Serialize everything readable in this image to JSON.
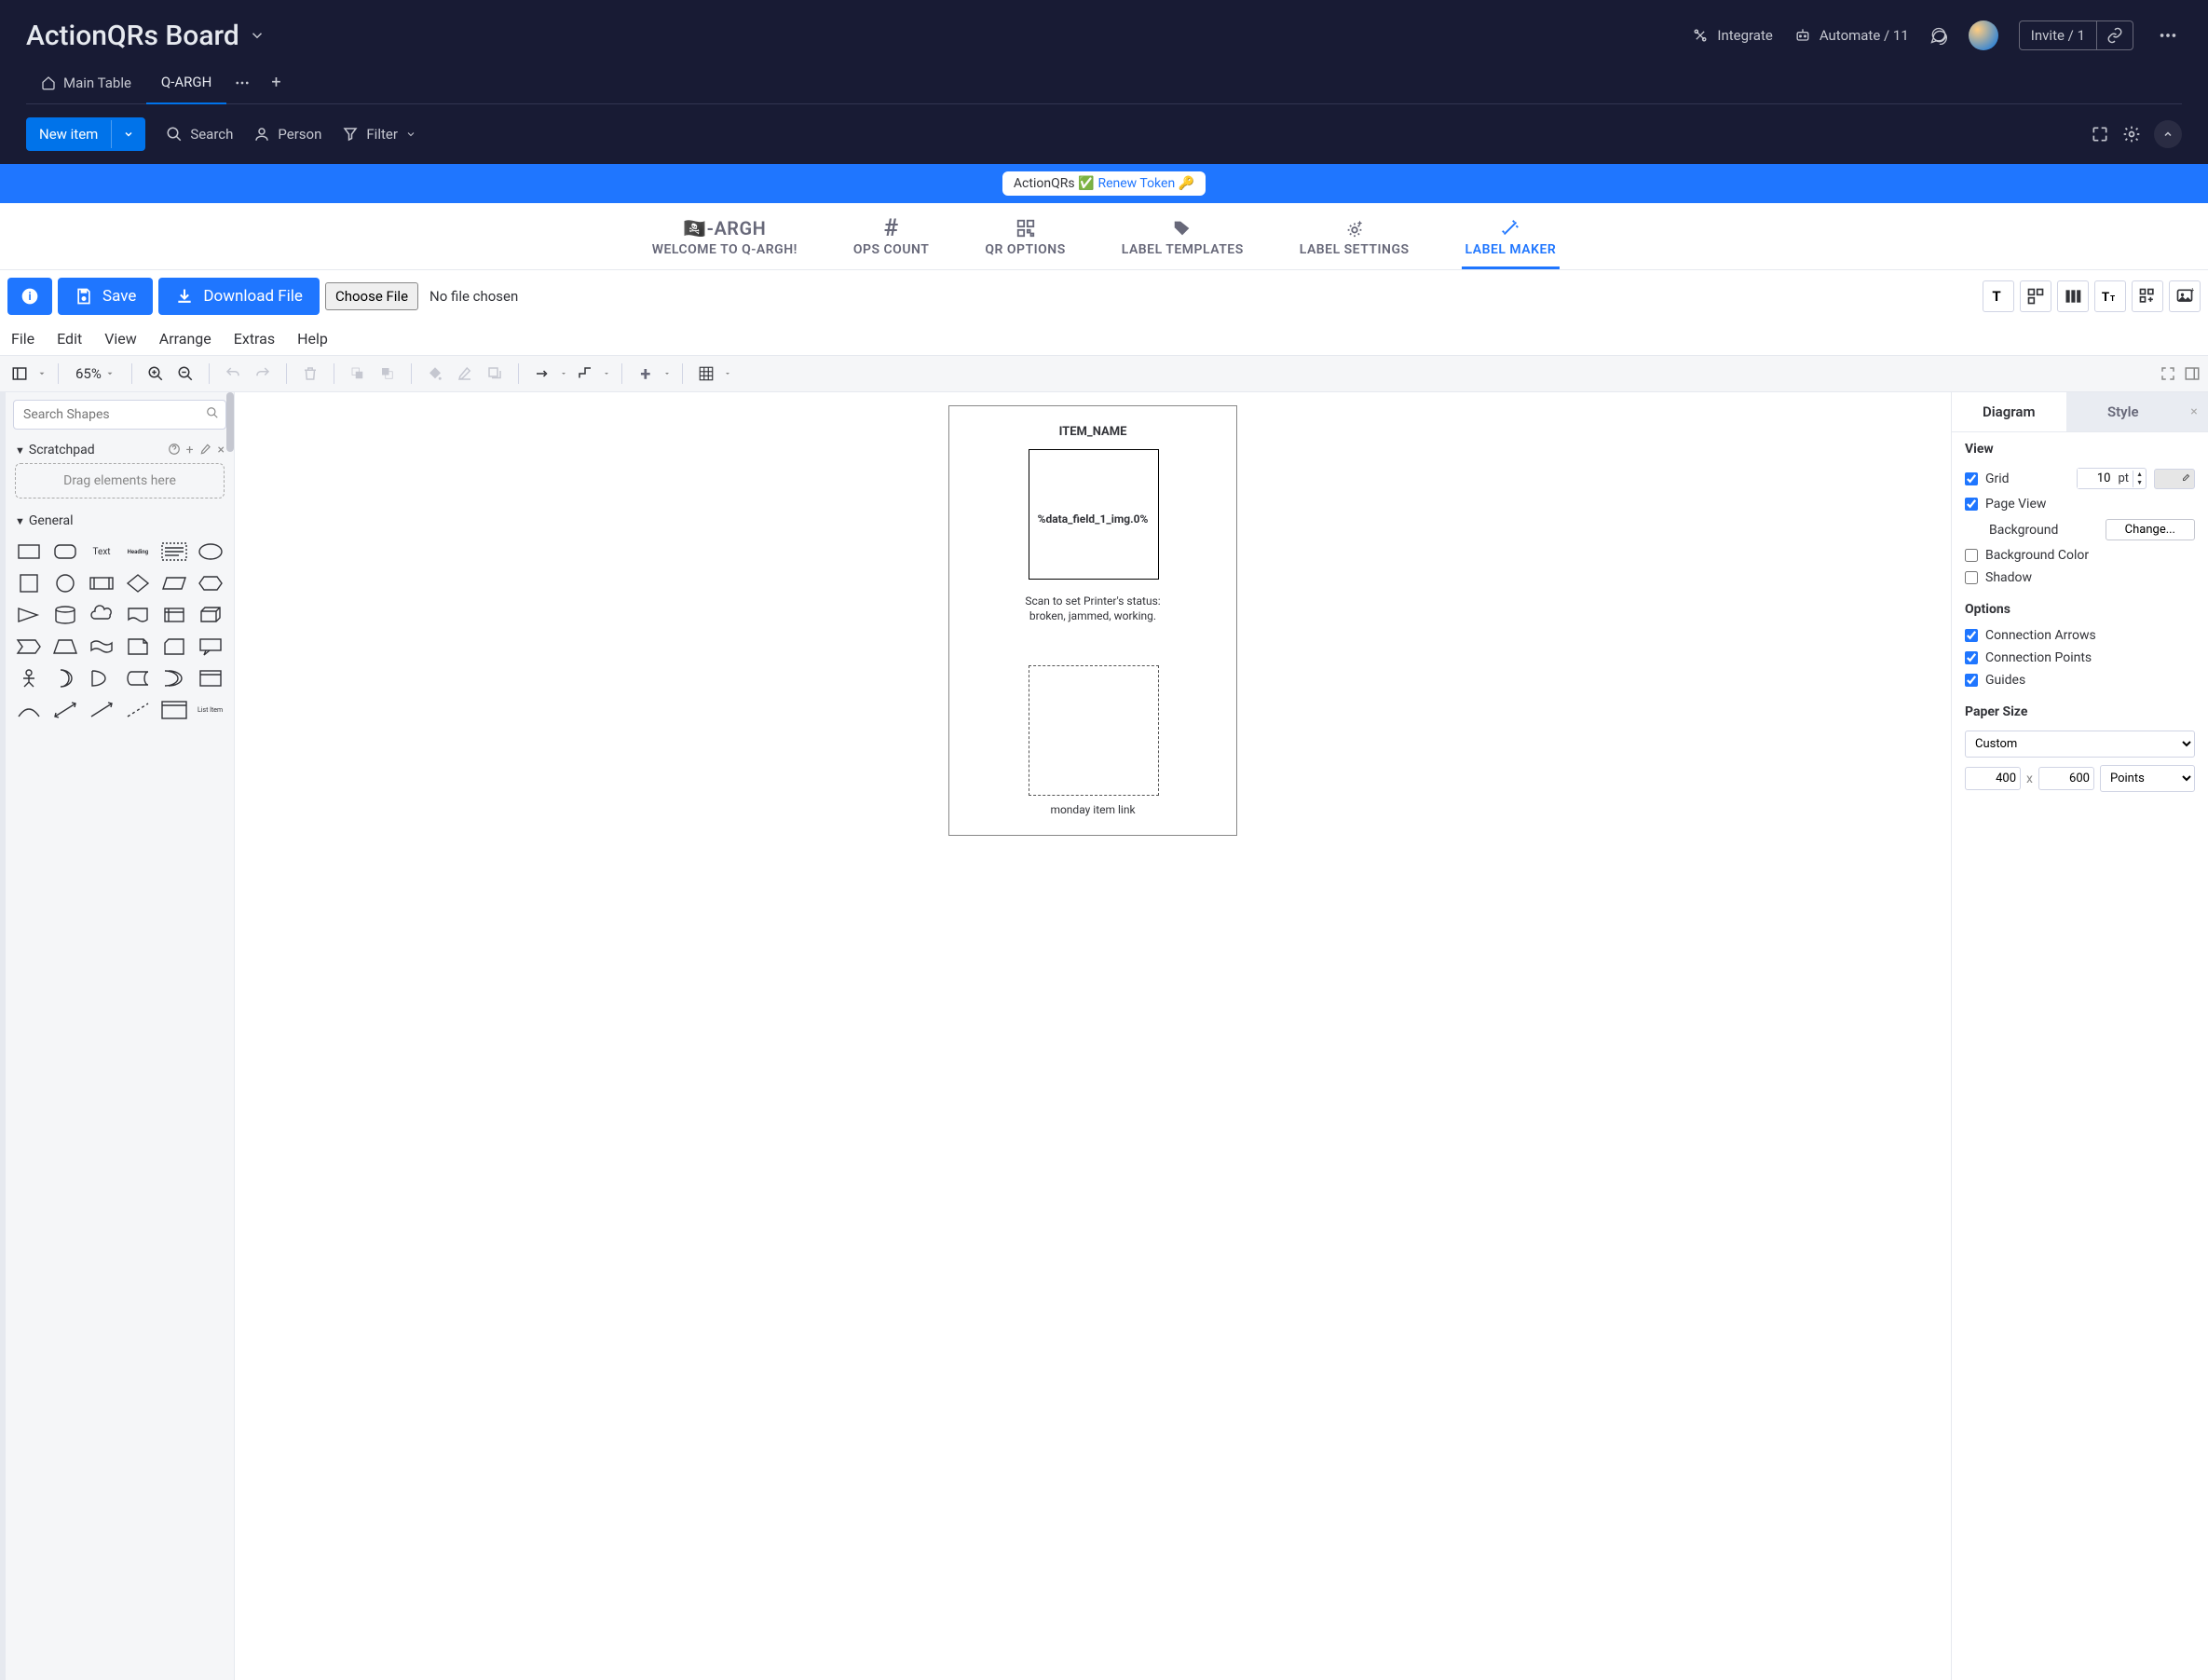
{
  "header": {
    "board_title": "ActionQRs Board",
    "integrate": "Integrate",
    "automate": "Automate / 11",
    "invite": "Invite / 1"
  },
  "tabs": {
    "main": "Main Table",
    "active": "Q-ARGH"
  },
  "actions": {
    "new_item": "New item",
    "search": "Search",
    "person": "Person",
    "filter": "Filter"
  },
  "banner": {
    "app": "ActionQRs ✅",
    "renew": "Renew Token 🔑"
  },
  "qargh_tabs": [
    {
      "label": "WELCOME TO Q-ARGH!",
      "icon": "🦜"
    },
    {
      "label": "OPS COUNT",
      "icon": "#"
    },
    {
      "label": "QR OPTIONS",
      "icon": "qr"
    },
    {
      "label": "LABEL TEMPLATES",
      "icon": "tag"
    },
    {
      "label": "LABEL SETTINGS",
      "icon": "gear"
    },
    {
      "label": "LABEL MAKER",
      "icon": "wand"
    }
  ],
  "toolbar": {
    "save": "Save",
    "download": "Download File",
    "choose": "Choose File",
    "nofile": "No file chosen"
  },
  "menu": [
    "File",
    "Edit",
    "View",
    "Arrange",
    "Extras",
    "Help"
  ],
  "zoom": "65%",
  "left_panel": {
    "search_placeholder": "Search Shapes",
    "scratchpad": "Scratchpad",
    "drag_hint": "Drag elements here",
    "general": "General",
    "text_label": "Text",
    "heading_label": "Heading",
    "list_label": "List Item"
  },
  "canvas": {
    "item_name": "ITEM_NAME",
    "placeholder": "%data_field_1_img.0%",
    "scan_text": "Scan to set Printer's status:\nbroken, jammed, working.",
    "link_text": "monday item link"
  },
  "right_panel": {
    "tab_diagram": "Diagram",
    "tab_style": "Style",
    "view_h": "View",
    "grid": "Grid",
    "grid_val": "10",
    "grid_unit": "pt",
    "page_view": "Page View",
    "background": "Background",
    "change": "Change...",
    "bg_color": "Background Color",
    "shadow": "Shadow",
    "options_h": "Options",
    "conn_arrows": "Connection Arrows",
    "conn_points": "Connection Points",
    "guides": "Guides",
    "paper_h": "Paper Size",
    "paper_preset": "Custom",
    "paper_w": "400",
    "paper_h_val": "600",
    "paper_unit": "Points"
  }
}
